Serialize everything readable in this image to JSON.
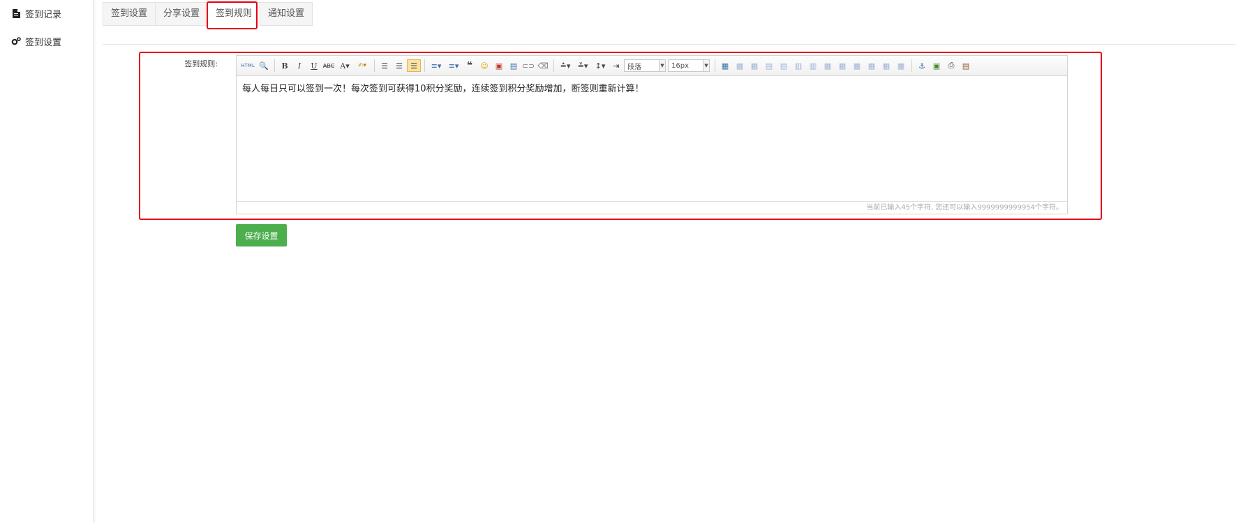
{
  "sidebar": {
    "items": [
      {
        "label": "签到记录",
        "icon": "file-icon"
      },
      {
        "label": "签到设置",
        "icon": "gears-icon"
      }
    ]
  },
  "tabs": [
    {
      "label": "签到设置",
      "active": false
    },
    {
      "label": "分享设置",
      "active": false
    },
    {
      "label": "签到规则",
      "active": true
    },
    {
      "label": "通知设置",
      "active": false
    }
  ],
  "form": {
    "rule_label": "签到规则:",
    "editor": {
      "toolbar": {
        "source_label": "HTML",
        "paragraph_select": "段落",
        "fontsize_select": "16px"
      },
      "content": "每人每日只可以签到一次！每次签到可获得10积分奖励，连续签到积分奖励增加，断签则重新计算！",
      "status": "当前已输入45个字符, 您还可以输入9999999999954个字符。"
    },
    "save_label": "保存设置"
  },
  "colors": {
    "highlight": "#e60012",
    "save_button": "#4cae4c"
  }
}
